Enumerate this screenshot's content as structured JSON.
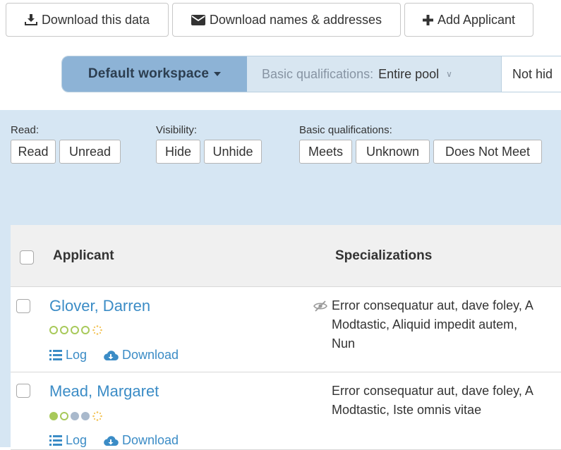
{
  "toolbar": {
    "download_data": "Download this data",
    "download_names": "Download names & addresses",
    "add_applicant": "Add Applicant"
  },
  "workspace": {
    "name": "Default workspace",
    "basic_label": "Basic qualifications:",
    "basic_value": "Entire pool",
    "hidden_value": "Not hid"
  },
  "filters": {
    "read_label": "Read:",
    "read": "Read",
    "unread": "Unread",
    "visibility_label": "Visibility:",
    "hide": "Hide",
    "unhide": "Unhide",
    "basic_label": "Basic qualifications:",
    "meets": "Meets",
    "unknown": "Unknown",
    "not_meet": "Does Not Meet"
  },
  "table": {
    "col_applicant": "Applicant",
    "col_specializations": "Specializations",
    "rows": [
      {
        "name": "Glover, Darren",
        "log": "Log",
        "download": "Download",
        "rating_filled": 0,
        "hidden": true,
        "spec_lines": [
          "Error consequatur aut, dave foley, A",
          "Modtastic, Aliquid impedit autem,",
          "Nun"
        ]
      },
      {
        "name": "Mead, Margaret",
        "log": "Log",
        "download": "Download",
        "rating_filled": 1,
        "hidden": false,
        "spec_lines": [
          "Error consequatur aut, dave foley, A",
          "Modtastic, Iste omnis vitae"
        ]
      }
    ]
  },
  "colors": {
    "link": "#3b8cc6",
    "workspace_active": "#8db3d6",
    "filter_bg": "#d6e6f3",
    "rating": "#a8c95a"
  },
  "icons": {
    "download_data": "download-tray-icon",
    "download_names": "envelope-icon",
    "add_applicant": "plus-icon",
    "log": "list-icon",
    "download": "cloud-download-icon",
    "hidden": "eye-slash-icon",
    "rating_extra": "sparkle-icon"
  }
}
